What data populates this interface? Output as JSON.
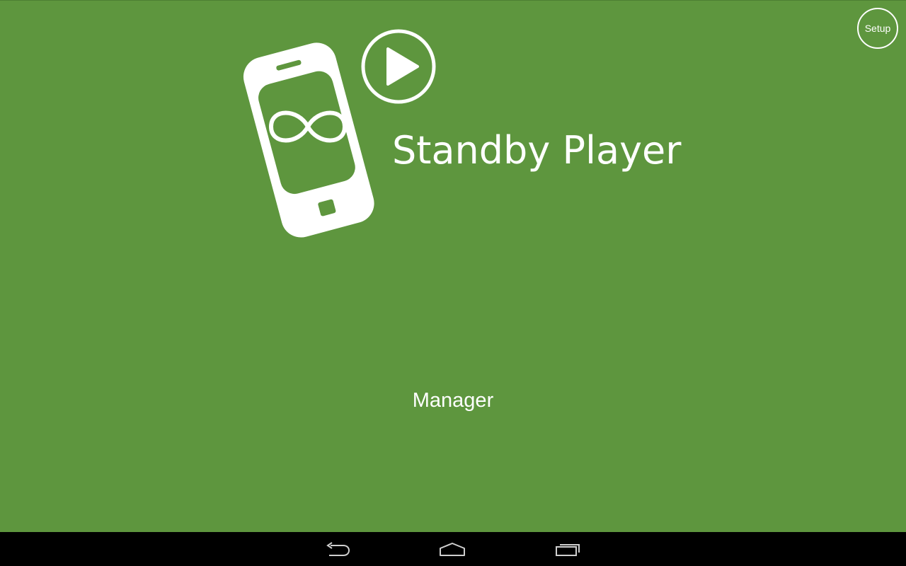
{
  "app": {
    "title": "Standby Player",
    "background_color": "#5e963e",
    "foreground_color": "#ffffff"
  },
  "header": {
    "setup_label": "Setup"
  },
  "logo": {
    "phone_icon": "phone-infinity-icon",
    "play_icon": "play-circle-icon"
  },
  "main": {
    "manager_label": "Manager"
  },
  "nav_bar": {
    "background_color": "#000000",
    "buttons": [
      {
        "icon": "back-icon"
      },
      {
        "icon": "home-icon"
      },
      {
        "icon": "recents-icon"
      }
    ]
  }
}
